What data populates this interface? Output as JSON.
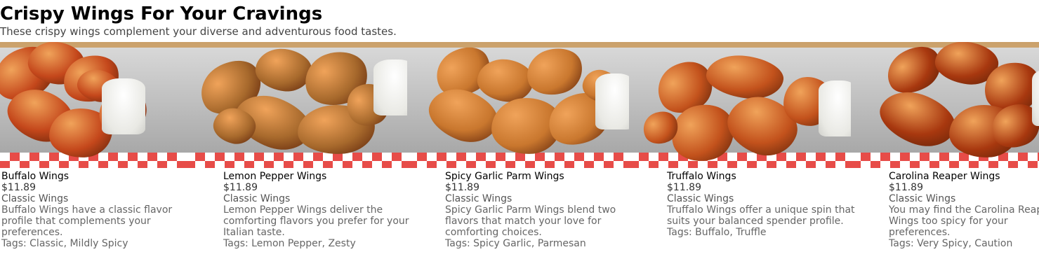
{
  "header": {
    "title": "Crispy Wings For Your Cravings",
    "subtitle": "These crispy wings complement your diverse and adventurous food tastes."
  },
  "items": [
    {
      "name": "Buffalo Wings",
      "price": "$11.89",
      "category": "Classic Wings",
      "description": "Buffalo Wings have a classic flavor profile that complements your preferences.",
      "tags": "Tags: Classic, Mildly Spicy",
      "image_alt": "Buffalo Wings photo",
      "wing_color": "#c4471b"
    },
    {
      "name": "Lemon Pepper Wings",
      "price": "$11.89",
      "category": "Classic Wings",
      "description": "Lemon Pepper Wings deliver the comforting flavors you prefer for your Italian taste.",
      "tags": "Tags: Lemon Pepper, Zesty",
      "image_alt": "Lemon Pepper Wings photo",
      "wing_color": "#a7692c"
    },
    {
      "name": "Spicy Garlic Parm Wings",
      "price": "$11.89",
      "category": "Classic Wings",
      "description": "Spicy Garlic Parm Wings blend two flavors that match your love for comforting choices.",
      "tags": "Tags: Spicy Garlic, Parmesan",
      "image_alt": "Spicy Garlic Parm Wings photo",
      "wing_color": "#c9772e"
    },
    {
      "name": "Truffalo Wings",
      "price": "$11.89",
      "category": "Classic Wings",
      "description": "Truffalo Wings offer a unique spin that suits your balanced spender profile.",
      "tags": "Tags: Buffalo, Truffle",
      "image_alt": "Truffalo Wings photo",
      "wing_color": "#c3521c"
    },
    {
      "name": "Carolina Reaper Wings",
      "price": "$11.89",
      "category": "Classic Wings",
      "description": "You may find the Carolina Reaper Wings too spicy for your preferences.",
      "tags": "Tags: Very Spicy, Caution",
      "image_alt": "Carolina Reaper Wings photo",
      "wing_color": "#a8380f"
    }
  ]
}
